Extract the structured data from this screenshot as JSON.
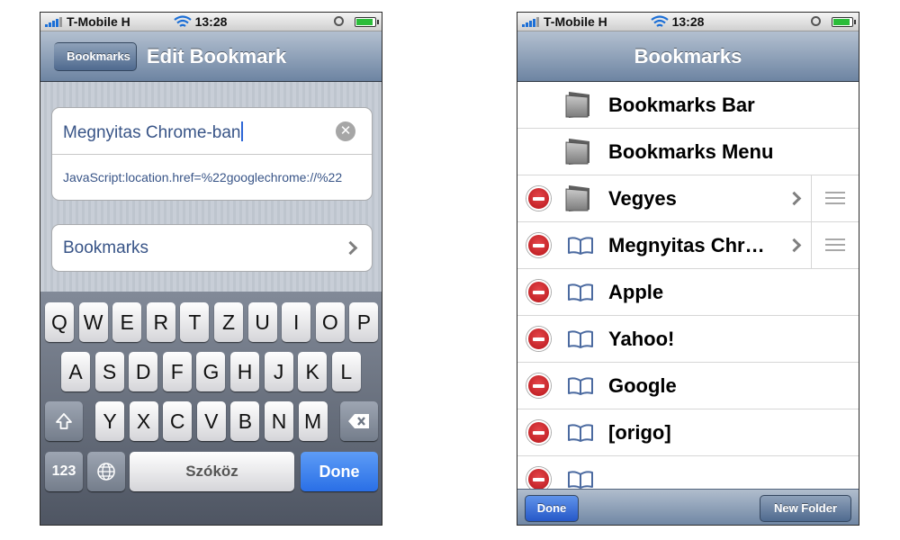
{
  "status_bar": {
    "carrier": "T-Mobile H",
    "time": "13:28"
  },
  "edit_screen": {
    "back_label": "Bookmarks",
    "title": "Edit Bookmark",
    "bookmark_title_value": "Megnyitas Chrome-ban",
    "bookmark_url_value": "JavaScript:location.href=%22googlechrome://%22",
    "folder_label": "Bookmarks"
  },
  "keyboard": {
    "row1": [
      "Q",
      "W",
      "E",
      "R",
      "T",
      "Z",
      "U",
      "I",
      "O",
      "P"
    ],
    "row2": [
      "A",
      "S",
      "D",
      "F",
      "G",
      "H",
      "J",
      "K",
      "L"
    ],
    "row3": [
      "Y",
      "X",
      "C",
      "V",
      "B",
      "N",
      "M"
    ],
    "num_label": "123",
    "space_label": "Szóköz",
    "done_label": "Done"
  },
  "bookmarks_screen": {
    "title": "Bookmarks",
    "items": [
      {
        "label": "Bookmarks Bar",
        "kind": "folder",
        "deletable": false,
        "chevron": false,
        "reorder": false
      },
      {
        "label": "Bookmarks Menu",
        "kind": "folder",
        "deletable": false,
        "chevron": false,
        "reorder": false
      },
      {
        "label": "Vegyes",
        "kind": "folder",
        "deletable": true,
        "chevron": true,
        "reorder": true
      },
      {
        "label": "Megnyitas Chr…",
        "kind": "bookmark",
        "deletable": true,
        "chevron": true,
        "reorder": true
      },
      {
        "label": "Apple",
        "kind": "bookmark",
        "deletable": true,
        "chevron": false,
        "reorder": false
      },
      {
        "label": "Yahoo!",
        "kind": "bookmark",
        "deletable": true,
        "chevron": false,
        "reorder": false
      },
      {
        "label": "Google",
        "kind": "bookmark",
        "deletable": true,
        "chevron": false,
        "reorder": false
      },
      {
        "label": "[origo]",
        "kind": "bookmark",
        "deletable": true,
        "chevron": false,
        "reorder": false
      }
    ],
    "done_label": "Done",
    "new_folder_label": "New Folder"
  },
  "colors": {
    "navbar_top": "#b3c0d0",
    "navbar_bottom": "#6d84a2",
    "field_text": "#385487",
    "delete_red": "#c8161b",
    "done_blue": "#2a6fe6",
    "signal_blue": "#1c6fd6",
    "battery_green": "#2bbd3a"
  },
  "icons": [
    "signal-icon",
    "wifi-icon",
    "lock-rotation-icon",
    "battery-icon",
    "clear-icon",
    "chevron-right-icon",
    "shift-icon",
    "backspace-icon",
    "globe-icon",
    "folder-icon",
    "book-icon",
    "delete-icon",
    "reorder-icon"
  ],
  "battery_level": 0.9
}
